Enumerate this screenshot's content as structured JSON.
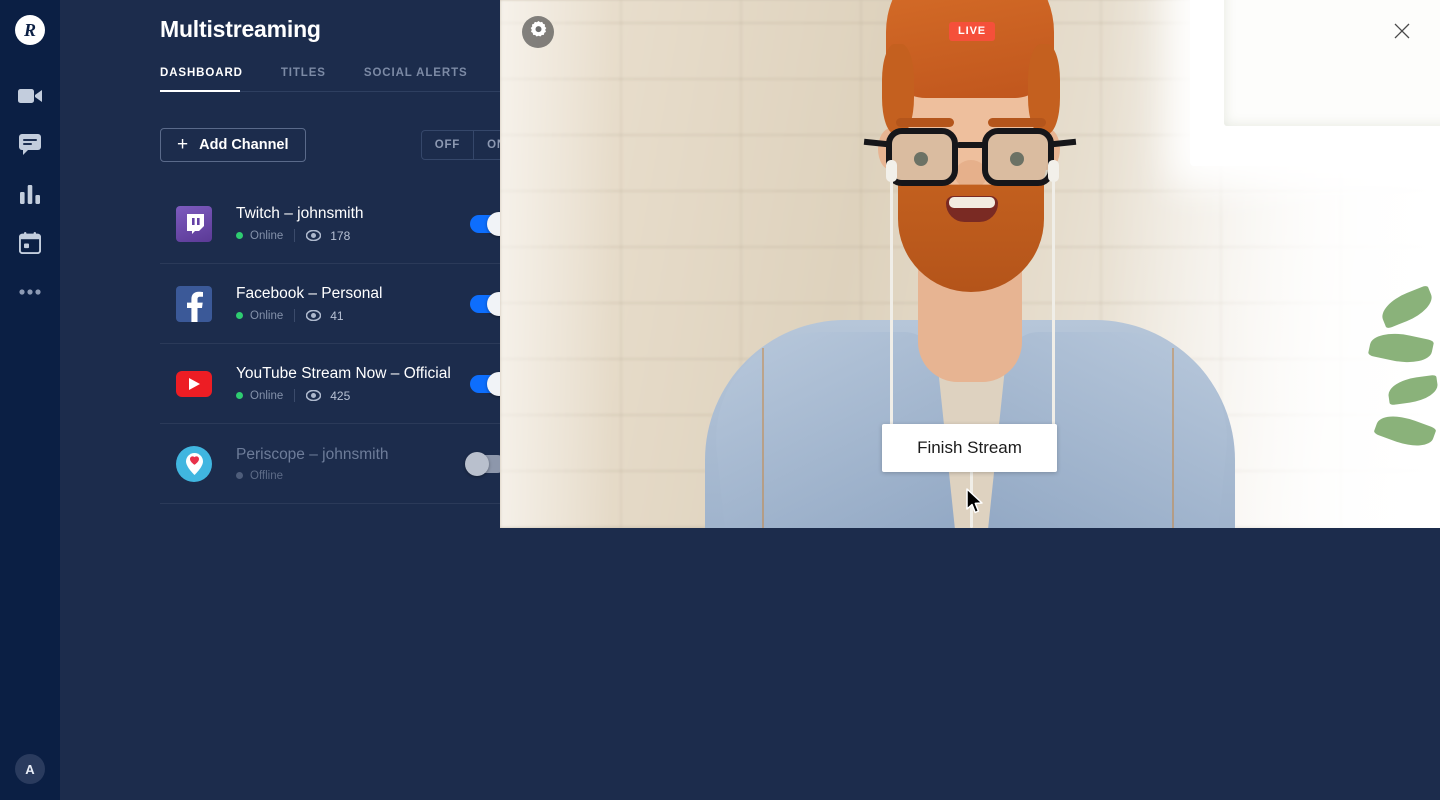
{
  "rail": {
    "logo_label": "R",
    "items": [
      {
        "name": "video-camera",
        "icon": "video-camera-icon"
      },
      {
        "name": "chat",
        "icon": "chat-bubble-icon"
      },
      {
        "name": "analytics",
        "icon": "bar-chart-icon"
      },
      {
        "name": "calendar",
        "icon": "calendar-icon"
      },
      {
        "name": "more",
        "icon": "more-dots-icon"
      }
    ],
    "avatar_initial": "A"
  },
  "panel": {
    "title": "Multistreaming",
    "tabs": [
      {
        "label": "DASHBOARD",
        "active": true
      },
      {
        "label": "TITLES",
        "active": false
      },
      {
        "label": "SOCIAL ALERTS",
        "active": false
      }
    ],
    "add_channel_label": "Add Channel",
    "add_channel_plus": "+",
    "segmented": {
      "off_label": "OFF",
      "on_label": "ON"
    }
  },
  "channels": [
    {
      "platform": "twitch",
      "name": "Twitch – johnsmith",
      "status": "Online",
      "online": true,
      "viewers": "178",
      "enabled": true
    },
    {
      "platform": "facebook",
      "name": "Facebook – Personal",
      "status": "Online",
      "online": true,
      "viewers": "41",
      "enabled": true
    },
    {
      "platform": "youtube",
      "name": "YouTube Stream Now – Official",
      "status": "Online",
      "online": true,
      "viewers": "425",
      "enabled": true
    },
    {
      "platform": "periscope",
      "name": "Periscope – johnsmith",
      "status": "Offline",
      "online": false,
      "viewers": "",
      "enabled": false
    }
  ],
  "video": {
    "live_badge": "LIVE",
    "finish_button": "Finish Stream",
    "settings_icon": "gear-icon",
    "close_icon": "close-icon",
    "cursor_icon": "mouse-pointer-icon"
  },
  "colors": {
    "rail_bg": "#0b1f44",
    "panel_bg": "#1c2c4c",
    "accent_blue": "#0d6efd",
    "live_red": "#f5503a",
    "online_green": "#2ecc71",
    "twitch_purple": "#6441a5",
    "facebook_blue": "#3b5998",
    "youtube_red": "#ed1d24",
    "periscope_blue": "#40b6e0"
  }
}
